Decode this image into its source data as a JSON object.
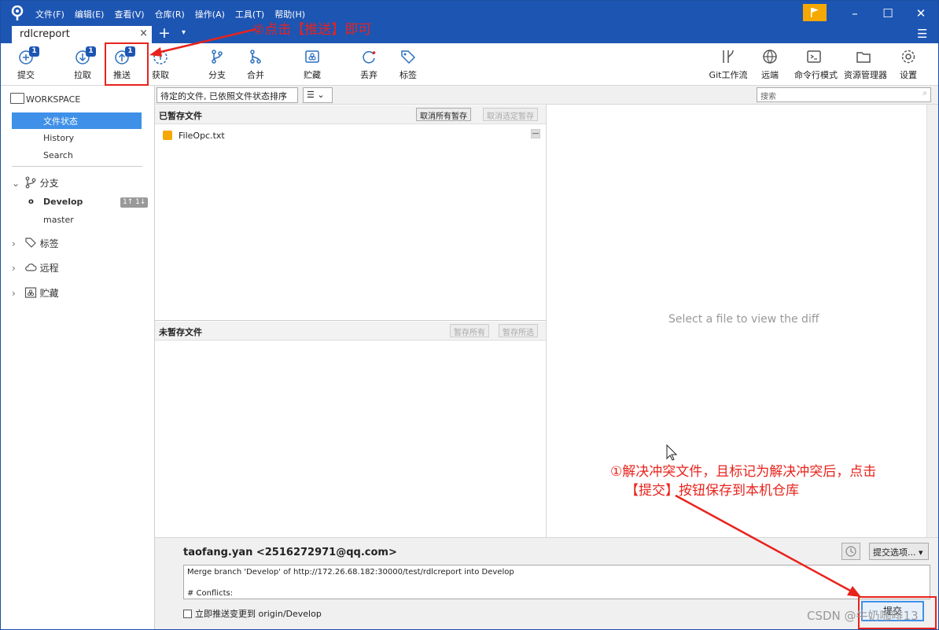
{
  "titlebar": {
    "menus": [
      "文件(F)",
      "编辑(E)",
      "查看(V)",
      "仓库(R)",
      "操作(A)",
      "工具(T)",
      "帮助(H)"
    ]
  },
  "tab": {
    "label": "rdlcreport",
    "close": "×",
    "add": "+",
    "dropdown": "▾",
    "menu": "☰"
  },
  "toolbar": {
    "commit": {
      "label": "提交",
      "badge": "1"
    },
    "pull": {
      "label": "拉取",
      "badge": "1"
    },
    "push": {
      "label": "推送",
      "badge": "1"
    },
    "fetch": {
      "label": "获取"
    },
    "branch": {
      "label": "分支"
    },
    "merge": {
      "label": "合并"
    },
    "stash": {
      "label": "贮藏"
    },
    "discard": {
      "label": "丢弃"
    },
    "tag": {
      "label": "标签"
    },
    "gitflow": {
      "label": "Git工作流"
    },
    "remote": {
      "label": "远端"
    },
    "terminal": {
      "label": "命令行模式"
    },
    "explorer": {
      "label": "资源管理器"
    },
    "settings": {
      "label": "设置"
    }
  },
  "annotations": {
    "push_hint": "②点击【推送】即可",
    "commit_hint_1": "①解决冲突文件，且标记为解决冲突后，点击",
    "commit_hint_2": "【提交】按钮保存到本机仓库"
  },
  "sidebar": {
    "workspace": "WORKSPACE",
    "file_status": "文件状态",
    "history": "History",
    "search": "Search",
    "branches": "分支",
    "develop": "Develop",
    "develop_badge": "1↑ 1↓",
    "master": "master",
    "tags": "标签",
    "remotes": "远程",
    "stashes": "贮藏"
  },
  "filter": {
    "sort": "待定的文件, 已依照文件状态排序",
    "view": "☰",
    "search_placeholder": "搜索"
  },
  "staged": {
    "title": "已暂存文件",
    "unstage_all": "取消所有暂存",
    "unstage_selected": "取消选定暂存",
    "files": [
      "FileOpc.txt"
    ]
  },
  "unstaged": {
    "title": "未暂存文件",
    "stage_all": "暂存所有",
    "stage_selected": "暂存所选"
  },
  "diff": {
    "placeholder": "Select a file to view the diff"
  },
  "commit": {
    "author": "taofang.yan <2516272971@qq.com>",
    "options": "提交选项... ▾",
    "message_line1": "Merge branch 'Develop' of http://172.26.68.182:30000/test/rdlcreport into Develop",
    "message_line2": "# Conflicts:",
    "push_now": "立即推送变更到 origin/Develop",
    "button": "提交"
  },
  "watermark": "CSDN @牛奶咖啡13",
  "colors": {
    "titlebar": "#1d55b3",
    "selected": "#3f90e8",
    "annotation": "#e8231c",
    "flag": "#f5a800"
  }
}
